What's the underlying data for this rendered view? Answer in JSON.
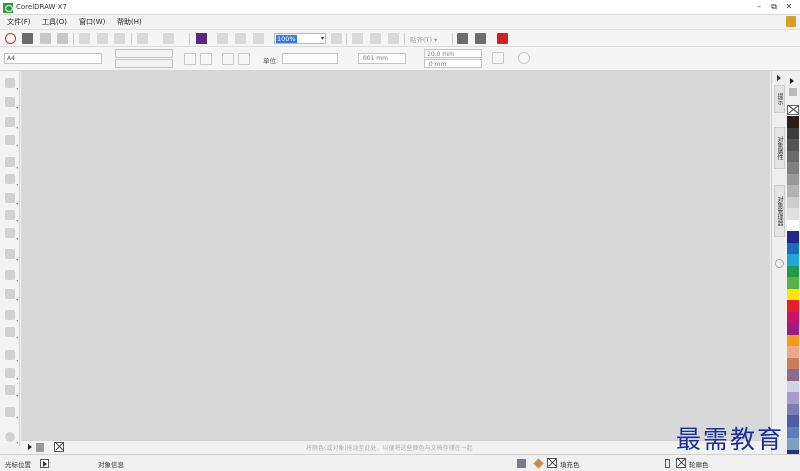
{
  "titlebar": {
    "title": "CorelDRAW X7",
    "minimize": "–",
    "restore": "⧉",
    "close": "✕"
  },
  "menubar": {
    "items": [
      "文件(F)",
      "工具(O)",
      "窗口(W)",
      "帮助(H)"
    ]
  },
  "standard_toolbar": {
    "zoom": "100%",
    "snap_label": "贴齐(T)",
    "snap_arrow": "▾"
  },
  "property_bar": {
    "page_size": "A4",
    "units_label": "单位:",
    "nudge": ".001 mm",
    "dup_x": "20.0 mm",
    "dup_y": ".0 mm"
  },
  "docker_tabs": [
    "提示",
    "对象属性",
    "对象管理器"
  ],
  "palette_colors": [
    "#2b1f14",
    "#3d3d3d",
    "#555555",
    "#6b6b6b",
    "#808080",
    "#9a9a9a",
    "#b3b3b3",
    "#cccccc",
    "#e0e0e0",
    "#ffffff",
    "#1f2a8c",
    "#1b6bb8",
    "#23a2dc",
    "#1f9a49",
    "#58b146",
    "#ffe500",
    "#e81e2a",
    "#c8136e",
    "#9b1f7e",
    "#f39a1e",
    "#f0a58c",
    "#c97b5c",
    "#8a6b8f",
    "#d2d2e6",
    "#a79bc8",
    "#7e7bb8",
    "#4f5ea8",
    "#5d7cb8",
    "#7da0c8",
    "#2a3570"
  ],
  "document_palette": {
    "hint": "将颜色(或对象)拖动至此处，以便将这些颜色与文档存储在一起"
  },
  "statusbar": {
    "cursor_label": "光标位置",
    "object_info": "对象信息",
    "fill_label": "填充色",
    "outline_label": "轮廓色"
  },
  "watermark": "最需教育"
}
